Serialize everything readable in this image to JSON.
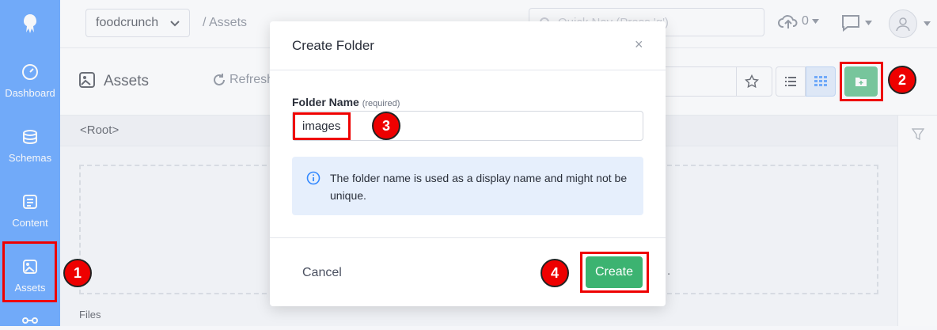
{
  "sidebar": {
    "items": [
      {
        "label": "Dashboard",
        "icon": "dashboard-icon"
      },
      {
        "label": "Schemas",
        "icon": "schemas-icon"
      },
      {
        "label": "Content",
        "icon": "content-icon"
      },
      {
        "label": "Assets",
        "icon": "assets-icon"
      }
    ]
  },
  "topbar": {
    "app_name": "foodcrunch",
    "breadcrumb": "/ Assets",
    "quicknav_placeholder": "Quick Nav (Press 'q')",
    "upload_count": "0"
  },
  "header": {
    "title": "Assets",
    "refresh_label": "Refresh"
  },
  "content": {
    "root_label": "<Root>",
    "files_label": "Files",
    "trailing_dot": "."
  },
  "modal": {
    "title": "Create Folder",
    "close": "×",
    "field_label": "Folder Name",
    "field_hint": "(required)",
    "field_value": "images",
    "info_text": "The folder name is used as a display name and might not be unique.",
    "cancel_label": "Cancel",
    "create_label": "Create"
  },
  "annotations": [
    "1",
    "2",
    "3",
    "4"
  ],
  "colors": {
    "sidebar": "#3389ff",
    "primary_green": "#3cb371",
    "annotation_red": "#ee0000",
    "info_bg": "#e6effc"
  }
}
